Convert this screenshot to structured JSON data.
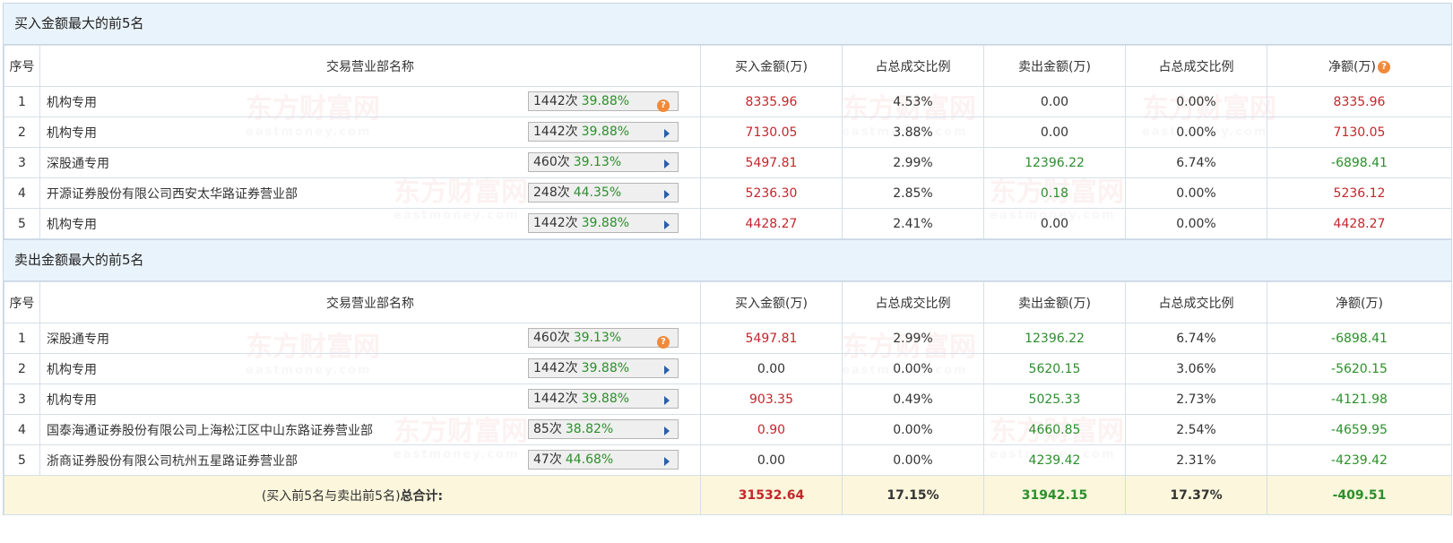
{
  "watermark": {
    "cn": "东方财富网",
    "en": "eastmoney.com"
  },
  "columns": [
    "序号",
    "交易营业部名称",
    "买入金额(万)",
    "占总成交比例",
    "卖出金额(万)",
    "占总成交比例",
    "净额(万)"
  ],
  "buy": {
    "title": "买入金额最大的前5名",
    "rows": [
      {
        "no": "1",
        "name": "机构专用",
        "times": "1442次",
        "pct": "39.88%",
        "icon": "question-icon",
        "buy": "8335.96",
        "buy_ratio": "4.53%",
        "sell": "0.00",
        "sell_ratio": "0.00%",
        "net": "8335.96"
      },
      {
        "no": "2",
        "name": "机构专用",
        "times": "1442次",
        "pct": "39.88%",
        "icon": "arrow-right-icon",
        "buy": "7130.05",
        "buy_ratio": "3.88%",
        "sell": "0.00",
        "sell_ratio": "0.00%",
        "net": "7130.05"
      },
      {
        "no": "3",
        "name": "深股通专用",
        "times": "460次",
        "pct": "39.13%",
        "icon": "arrow-right-icon",
        "buy": "5497.81",
        "buy_ratio": "2.99%",
        "sell": "12396.22",
        "sell_ratio": "6.74%",
        "net": "-6898.41"
      },
      {
        "no": "4",
        "name": "开源证券股份有限公司西安太华路证券营业部",
        "times": "248次",
        "pct": "44.35%",
        "icon": "arrow-right-icon",
        "buy": "5236.30",
        "buy_ratio": "2.85%",
        "sell": "0.18",
        "sell_ratio": "0.00%",
        "net": "5236.12"
      },
      {
        "no": "5",
        "name": "机构专用",
        "times": "1442次",
        "pct": "39.88%",
        "icon": "arrow-right-icon",
        "buy": "4428.27",
        "buy_ratio": "2.41%",
        "sell": "0.00",
        "sell_ratio": "0.00%",
        "net": "4428.27"
      }
    ]
  },
  "sell": {
    "title": "卖出金额最大的前5名",
    "rows": [
      {
        "no": "1",
        "name": "深股通专用",
        "times": "460次",
        "pct": "39.13%",
        "icon": "question-icon",
        "buy": "5497.81",
        "buy_ratio": "2.99%",
        "sell": "12396.22",
        "sell_ratio": "6.74%",
        "net": "-6898.41"
      },
      {
        "no": "2",
        "name": "机构专用",
        "times": "1442次",
        "pct": "39.88%",
        "icon": "arrow-right-icon",
        "buy": "0.00",
        "buy_ratio": "0.00%",
        "sell": "5620.15",
        "sell_ratio": "3.06%",
        "net": "-5620.15"
      },
      {
        "no": "3",
        "name": "机构专用",
        "times": "1442次",
        "pct": "39.88%",
        "icon": "arrow-right-icon",
        "buy": "903.35",
        "buy_ratio": "0.49%",
        "sell": "5025.33",
        "sell_ratio": "2.73%",
        "net": "-4121.98"
      },
      {
        "no": "4",
        "name": "国泰海通证券股份有限公司上海松江区中山东路证券营业部",
        "times": "85次",
        "pct": "38.82%",
        "icon": "arrow-right-icon",
        "buy": "0.90",
        "buy_ratio": "0.00%",
        "sell": "4660.85",
        "sell_ratio": "2.54%",
        "net": "-4659.95"
      },
      {
        "no": "5",
        "name": "浙商证券股份有限公司杭州五星路证券营业部",
        "times": "47次",
        "pct": "44.68%",
        "icon": "arrow-right-icon",
        "buy": "0.00",
        "buy_ratio": "0.00%",
        "sell": "4239.42",
        "sell_ratio": "2.31%",
        "net": "-4239.42"
      }
    ]
  },
  "total": {
    "label_prefix": "(买入前5名与卖出前5名)",
    "label_bold": "总合计:",
    "buy": "31532.64",
    "buy_ratio": "17.15%",
    "sell": "31942.15",
    "sell_ratio": "17.37%",
    "net": "-409.51"
  },
  "colors": {
    "positive": "#c3262b",
    "negative": "#2c8f2c",
    "header_bg": "#e9f3fb",
    "total_bg": "#fbf6dc"
  }
}
